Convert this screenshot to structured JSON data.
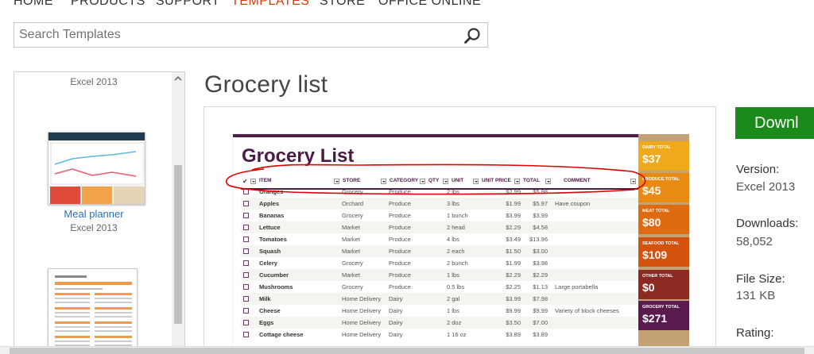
{
  "nav": {
    "items": [
      {
        "label": "HOME",
        "active": false
      },
      {
        "label": "PRODUCTS",
        "active": false
      },
      {
        "label": "SUPPORT",
        "active": false
      },
      {
        "label": "TEMPLATES",
        "active": true
      },
      {
        "label": "STORE",
        "active": false
      },
      {
        "label": "OFFICE ONLINE",
        "active": false
      }
    ]
  },
  "search": {
    "placeholder": "Search Templates",
    "icon": "search-icon"
  },
  "sidebar": {
    "items": [
      {
        "title": "",
        "app": "Excel 2013"
      },
      {
        "title": "Meal planner",
        "app": "Excel 2013"
      }
    ]
  },
  "template": {
    "title": "Grocery list"
  },
  "preview": {
    "sheet_title": "Grocery List",
    "columns": [
      "ITEM",
      "STORE",
      "CATEGORY",
      "QTY",
      "UNIT",
      "UNIT PRICE",
      "TOTAL",
      "COMMENT"
    ],
    "rows": [
      {
        "item": "Oranges",
        "store": "Grocery",
        "category": "Produce",
        "qty": "2 lbs",
        "price": "$2.99",
        "total": "$5.98",
        "comment": ""
      },
      {
        "item": "Apples",
        "store": "Orchard",
        "category": "Produce",
        "qty": "3 lbs",
        "price": "$1.99",
        "total": "$5.97",
        "comment": "Have coupon"
      },
      {
        "item": "Bananas",
        "store": "Grocery",
        "category": "Produce",
        "qty": "1 bunch",
        "price": "$3.99",
        "total": "$3.99",
        "comment": ""
      },
      {
        "item": "Lettuce",
        "store": "Market",
        "category": "Produce",
        "qty": "2 head",
        "price": "$2.29",
        "total": "$4.58",
        "comment": ""
      },
      {
        "item": "Tomatoes",
        "store": "Market",
        "category": "Produce",
        "qty": "4 lbs",
        "price": "$3.49",
        "total": "$13.96",
        "comment": ""
      },
      {
        "item": "Squash",
        "store": "Market",
        "category": "Produce",
        "qty": "2 each",
        "price": "$1.50",
        "total": "$3.00",
        "comment": ""
      },
      {
        "item": "Celery",
        "store": "Grocery",
        "category": "Produce",
        "qty": "2 bunch",
        "price": "$1.99",
        "total": "$3.98",
        "comment": ""
      },
      {
        "item": "Cucumber",
        "store": "Market",
        "category": "Produce",
        "qty": "1 lbs",
        "price": "$2.29",
        "total": "$2.29",
        "comment": ""
      },
      {
        "item": "Mushrooms",
        "store": "Grocery",
        "category": "Produce",
        "qty": "0.5 lbs",
        "price": "$2.25",
        "total": "$1.13",
        "comment": "Large portabella"
      },
      {
        "item": "Milk",
        "store": "Home Delivery",
        "category": "Dairy",
        "qty": "2 gal",
        "price": "$3.99",
        "total": "$7.98",
        "comment": ""
      },
      {
        "item": "Cheese",
        "store": "Home Delivery",
        "category": "Dairy",
        "qty": "1 lbs",
        "price": "$9.99",
        "total": "$9.99",
        "comment": "Variety of block cheeses"
      },
      {
        "item": "Eggs",
        "store": "Home Delivery",
        "category": "Dairy",
        "qty": "2 doz",
        "price": "$3.50",
        "total": "$7.00",
        "comment": ""
      },
      {
        "item": "Cottage cheese",
        "store": "Home Delivery",
        "category": "Dairy",
        "qty": "1 16 oz",
        "price": "$3.89",
        "total": "$3.89",
        "comment": ""
      }
    ],
    "tiles": [
      {
        "label": "DAIRY TOTAL",
        "value": "$37",
        "color": "#f0a81c"
      },
      {
        "label": "PRODUCE TOTAL",
        "value": "$45",
        "color": "#e98a13"
      },
      {
        "label": "MEAT TOTAL",
        "value": "$80",
        "color": "#de6b10"
      },
      {
        "label": "SEAFOOD TOTAL",
        "value": "$109",
        "color": "#d2520e"
      },
      {
        "label": "OTHER TOTAL",
        "value": "$0",
        "color": "#8c2a22"
      },
      {
        "label": "GROCERY TOTAL",
        "value": "$271",
        "color": "#5a1a4e"
      }
    ]
  },
  "details": {
    "download_label": "Downl",
    "version_label": "Version:",
    "version_value": "Excel 2013",
    "downloads_label": "Downloads:",
    "downloads_value": "58,052",
    "filesize_label": "File Size:",
    "filesize_value": "131 KB",
    "rating_label": "Rating:"
  },
  "colors": {
    "active_nav": "#d83b01",
    "link": "#2a6ebb",
    "download_button": "#1a8a1a",
    "sheet_accent": "#4b1a46",
    "annotation": "#e00000"
  }
}
